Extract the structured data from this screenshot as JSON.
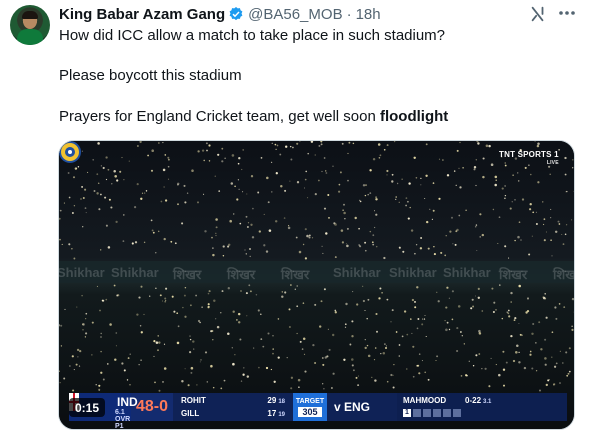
{
  "author": {
    "name": "King Babar Azam Gang",
    "handle": "@BA56_MOB",
    "separator": "·",
    "time": "18h",
    "verified_color": "#1d9bf0"
  },
  "tweet": {
    "line1": "How did ICC allow a match to take place in such stadium?",
    "line2": "Please boycott this stadium",
    "line3_text": "Prayers for England Cricket team, get well soon ",
    "line3_hashtag": "floodlight"
  },
  "icons": {
    "grok": "grok-icon",
    "more": "more-icon",
    "verified": "verified-badge-icon"
  },
  "media": {
    "broadcaster": "TNT SPORTS 1",
    "broadcaster_sub": "LIVE",
    "stands_banner": [
      "Shikhar",
      "Shikhar",
      "शिखर",
      "शिखर",
      "शिखर",
      "Shikhar",
      "Shikhar",
      "Shikhar",
      "शिखर",
      "शिखर"
    ],
    "video_time": "0:15",
    "scoreboard": {
      "team": "IND",
      "overs": "6.1",
      "overs_label": "OVR",
      "powerplay": "P1",
      "score": "48-0",
      "batter1": "ROHIT",
      "batter1_runs": "29",
      "batter1_balls": "18",
      "batter2": "GILL",
      "batter2_runs": "17",
      "batter2_balls": "19",
      "target_label": "TARGET",
      "target_value": "305",
      "versus": "v ENG",
      "bowler": "MAHMOOD",
      "bowler_figures": "0-22",
      "bowler_overs": "3.1",
      "ball_marker": "1"
    }
  }
}
